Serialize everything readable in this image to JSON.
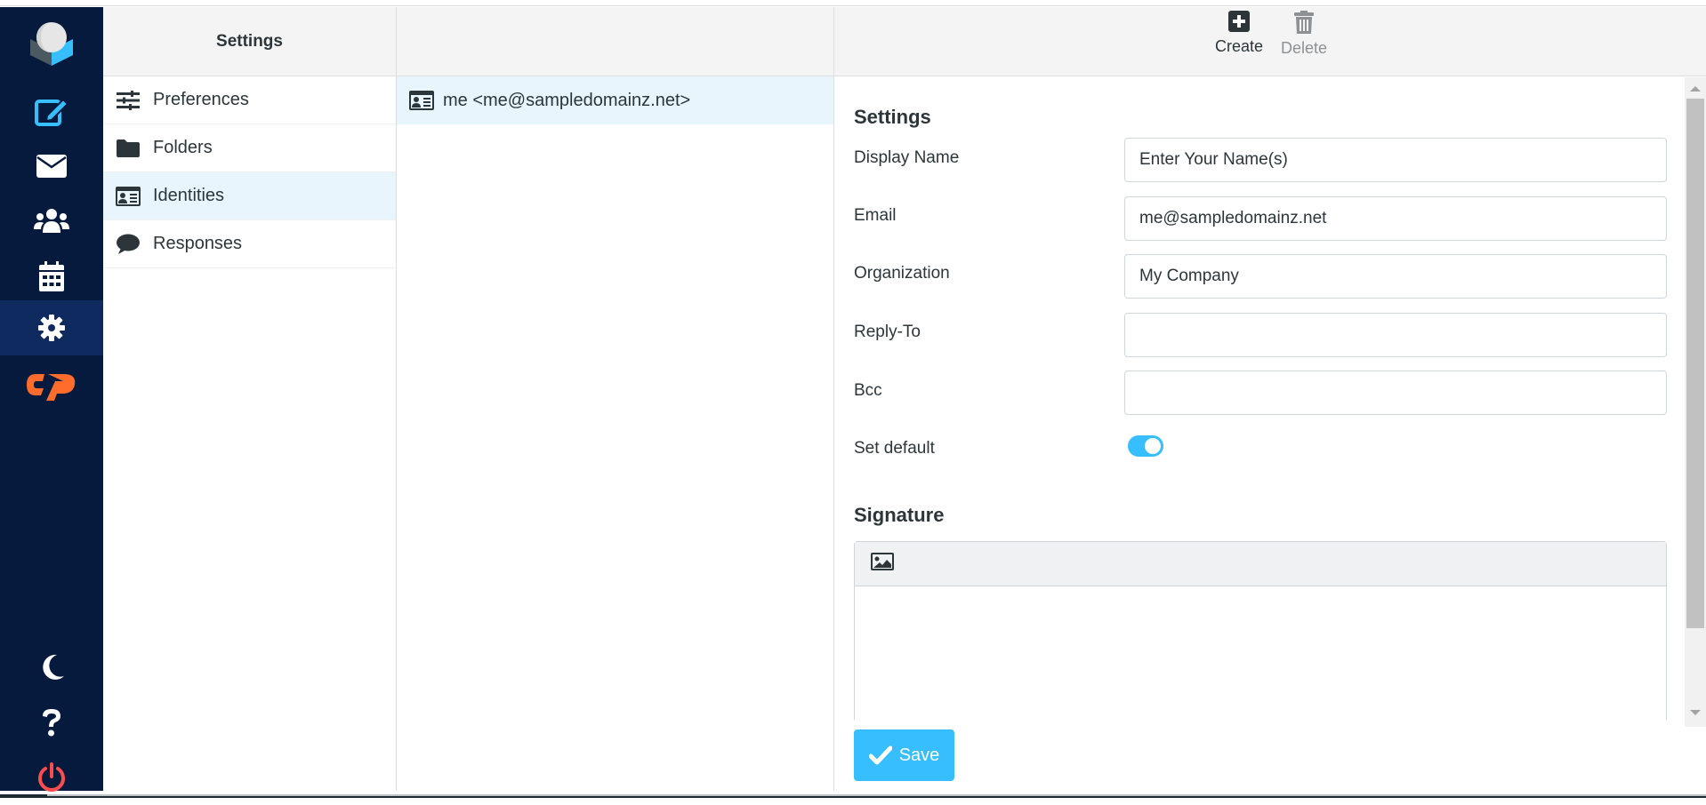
{
  "nav": {
    "items": [
      {
        "name": "logo",
        "icon": "roundcube-logo-icon"
      },
      {
        "name": "compose",
        "icon": "compose-icon",
        "color": "#37beff"
      },
      {
        "name": "mail",
        "icon": "envelope-icon"
      },
      {
        "name": "contacts",
        "icon": "users-icon"
      },
      {
        "name": "calendar",
        "icon": "calendar-icon"
      },
      {
        "name": "settings",
        "icon": "gear-icon",
        "active": true
      },
      {
        "name": "cpanel",
        "icon": "cpanel-icon",
        "color": "#ff6c2c"
      },
      {
        "name": "dark-mode",
        "icon": "moon-icon"
      },
      {
        "name": "help",
        "icon": "question-icon"
      },
      {
        "name": "logout",
        "icon": "power-icon",
        "color": "#ff4d4d"
      }
    ]
  },
  "settings_column": {
    "title": "Settings",
    "items": [
      {
        "label": "Preferences",
        "icon": "sliders-icon"
      },
      {
        "label": "Folders",
        "icon": "folder-icon"
      },
      {
        "label": "Identities",
        "icon": "id-card-icon",
        "selected": true
      },
      {
        "label": "Responses",
        "icon": "comment-icon"
      }
    ]
  },
  "identities_column": {
    "items": [
      {
        "label": "me <me@sampledomainz.net>",
        "icon": "id-card-icon",
        "selected": true
      }
    ]
  },
  "toolbar": {
    "create_label": "Create",
    "delete_label": "Delete"
  },
  "form": {
    "section_title": "Settings",
    "fields": {
      "display_name": {
        "label": "Display Name",
        "value": "Enter Your Name(s)"
      },
      "email": {
        "label": "Email",
        "value": "me@sampledomainz.net"
      },
      "organization": {
        "label": "Organization",
        "value": "My Company"
      },
      "reply_to": {
        "label": "Reply-To",
        "value": ""
      },
      "bcc": {
        "label": "Bcc",
        "value": ""
      },
      "set_default": {
        "label": "Set default",
        "checked": true
      }
    },
    "signature_title": "Signature",
    "signature_value": "",
    "save_label": "Save"
  },
  "colors": {
    "nav_bg": "#061a3d",
    "nav_active": "#0f2a5e",
    "accent": "#37beff",
    "selected_row": "#e8f5fc"
  }
}
